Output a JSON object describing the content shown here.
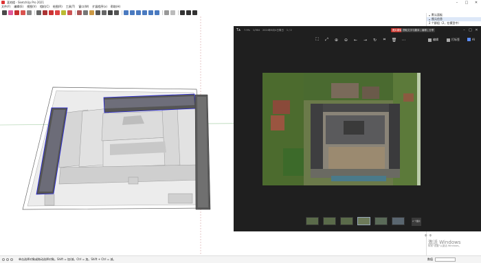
{
  "app": {
    "title": "某地楼 - SketchUp Pro 2021"
  },
  "menu": [
    "文件(F)",
    "编辑(E)",
    "视图(V)",
    "相机(C)",
    "绘图(R)",
    "工具(T)",
    "窗口(W)",
    "扩展程序(x)",
    "帮助(H)"
  ],
  "tray": {
    "rows": [
      {
        "label": "默认面板",
        "selected": false
      },
      {
        "label": "图元信息",
        "selected": true
      },
      {
        "label": "2 个群组（2，在模型中）",
        "selected": false
      }
    ]
  },
  "viewer": {
    "logo": "Tᴀ",
    "tabs": [
      "7.9%",
      "1/364",
      "2024年8月4日周日",
      "1 / 2"
    ],
    "badge": "图片翻译完成",
    "badge2": "提取文字与翻译 | 编辑 | 分享",
    "tool_labels": {
      "edit": "编辑",
      "tag": "打标签",
      "ai": "AI"
    }
  },
  "watermark": {
    "line1": "激活 Windows",
    "line2": "转到\"设置\"以激活 Windows。"
  },
  "system": {
    "lang": "中",
    "time": "中",
    "meta": "2 个图片"
  },
  "status": {
    "text": "单击选择对象或拖动选择对象。Shift = 加/减。Ctrl = 加。Shift + Ctrl = 减。",
    "measure_label": "数值",
    "measure_value": ""
  },
  "colors": {
    "accent": "#c8352e",
    "viewer_bg": "#1f1f1f",
    "selection": "#2222dd"
  }
}
